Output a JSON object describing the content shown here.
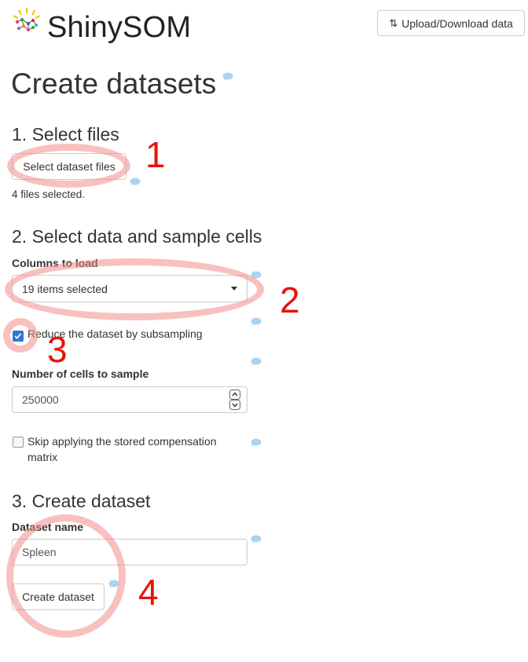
{
  "header": {
    "brand": "ShinySOM",
    "upload_download_label": "Upload/Download data",
    "upload_download_icon": "swap-icon"
  },
  "page": {
    "title": "Create datasets"
  },
  "step1": {
    "heading": "1. Select files",
    "select_files_label": "Select dataset files",
    "status": "4 files selected."
  },
  "step2": {
    "heading": "2. Select data and sample cells",
    "columns_label": "Columns to load",
    "columns_value": "19 items selected",
    "subsample_label": "Reduce the dataset by subsampling",
    "subsample_checked": true,
    "cells_label": "Number of cells to sample",
    "cells_value": "250000",
    "skip_comp_label": "Skip applying the stored compensation matrix",
    "skip_comp_checked": false
  },
  "step3": {
    "heading": "3. Create dataset",
    "name_label": "Dataset name",
    "name_value": "Spleen",
    "create_label": "Create dataset"
  },
  "annotations": {
    "n1": "1",
    "n2": "2",
    "n3": "3",
    "n4": "4"
  },
  "colors": {
    "annotation_red": "#e8140a",
    "ring_pink": "#f48c8c",
    "help_blue": "#a9d3f2",
    "check_blue": "#2f77d1"
  }
}
